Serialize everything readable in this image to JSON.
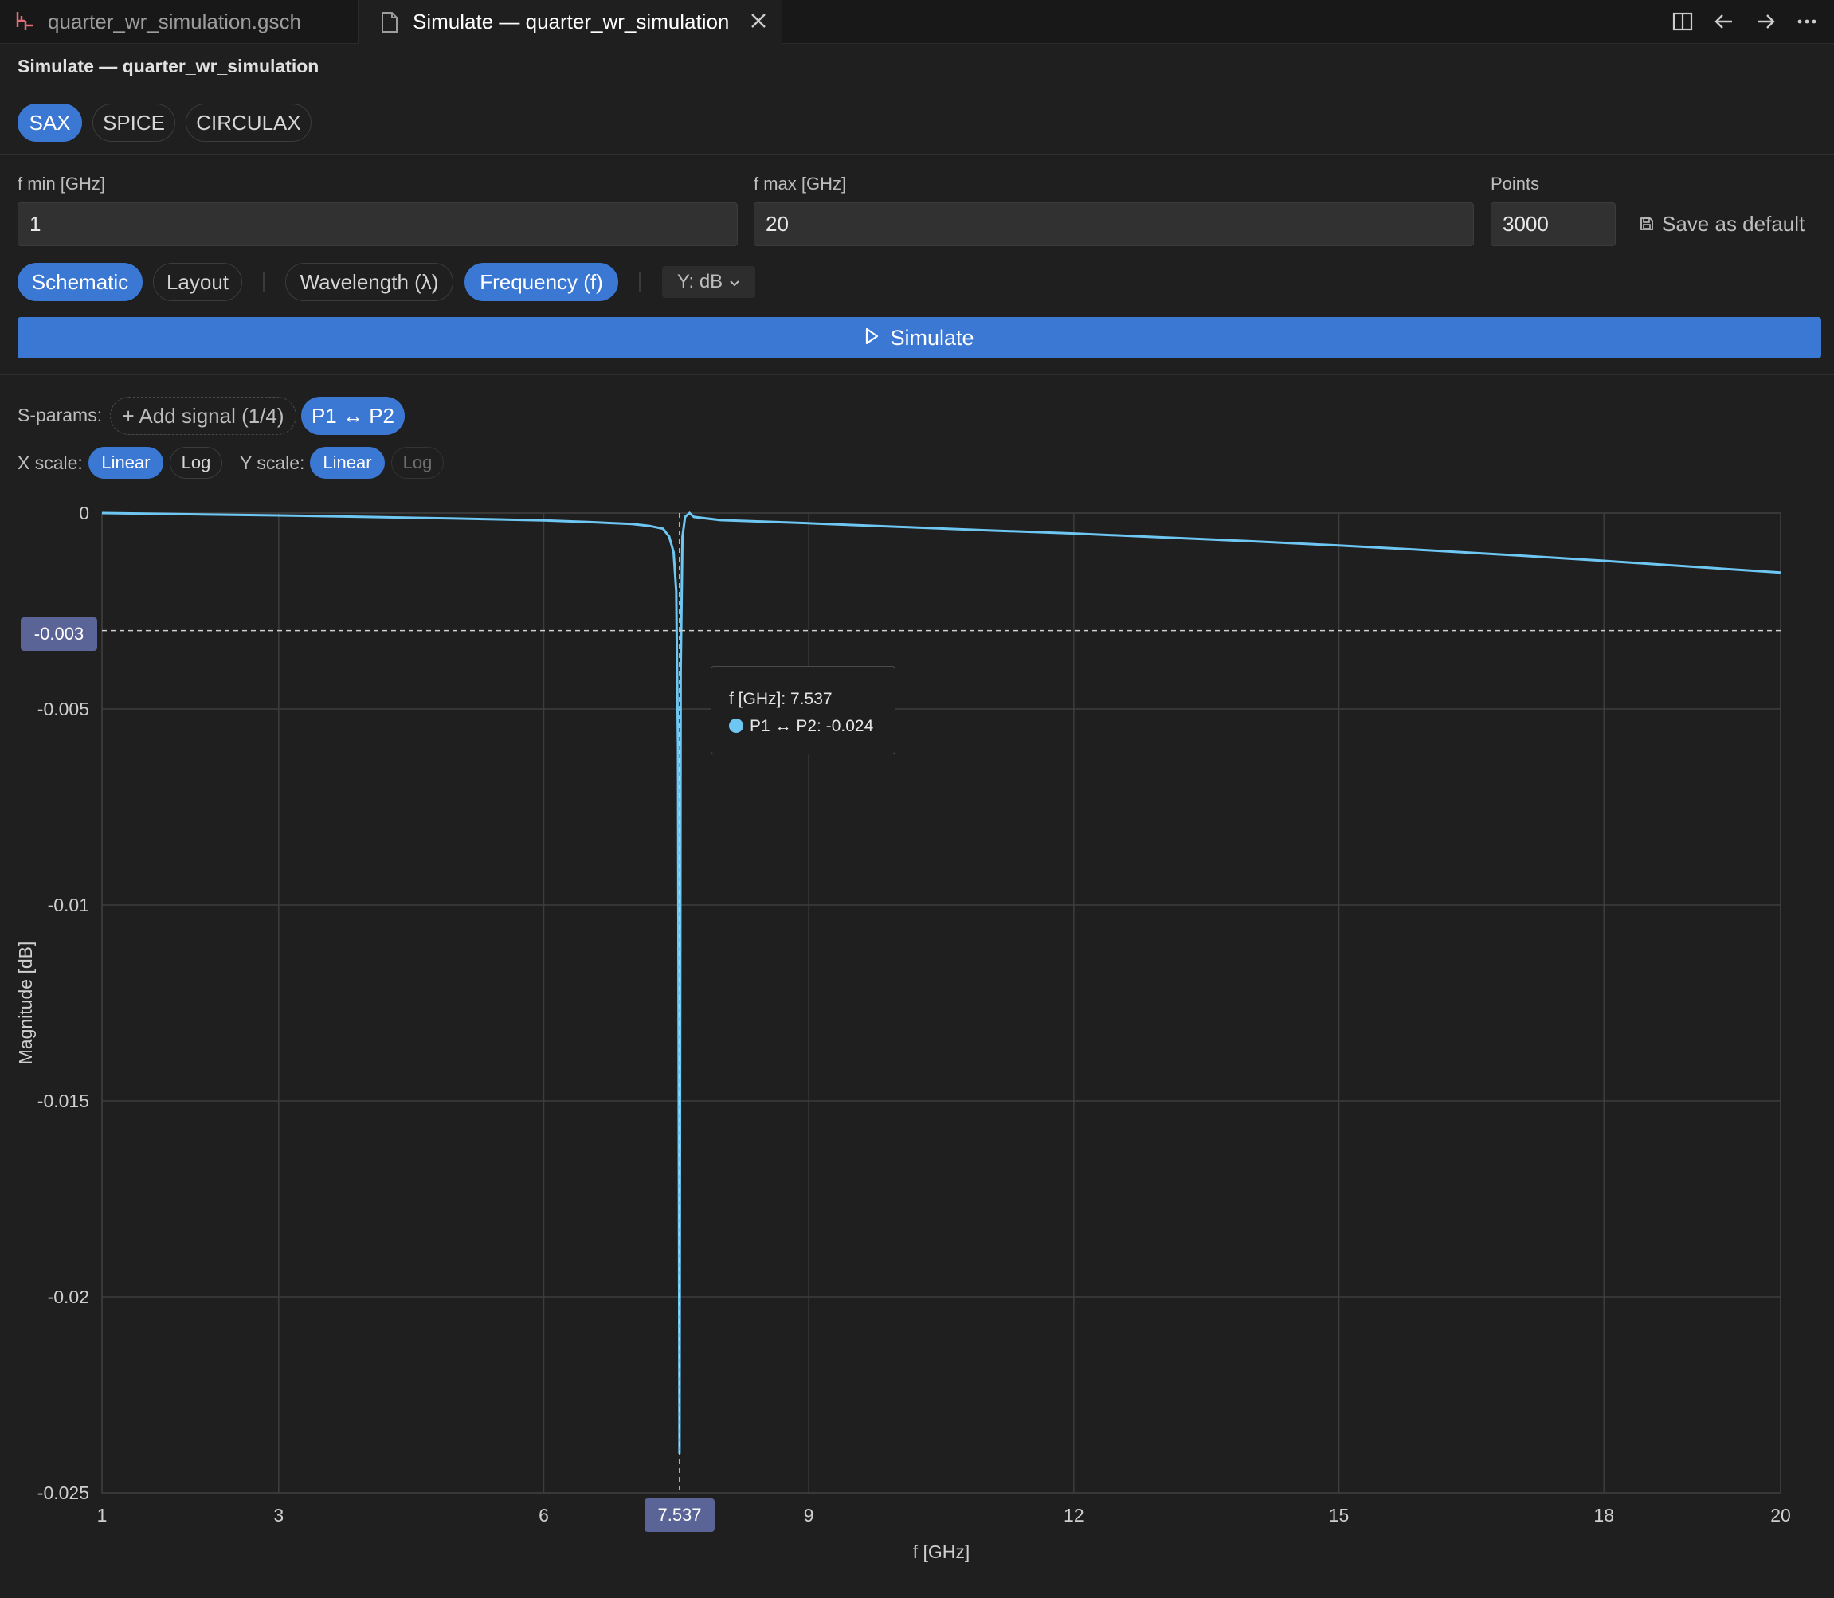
{
  "tabs": [
    {
      "label": "quarter_wr_simulation.gsch",
      "icon": "schematic-file-icon"
    },
    {
      "label": "Simulate — quarter_wr_simulation",
      "icon": "file-icon",
      "close_icon": "close-icon"
    }
  ],
  "toolbar_icons": [
    "split-editor-icon",
    "arrow-left-icon",
    "arrow-right-icon",
    "more-icon"
  ],
  "panel_title": "Simulate — quarter_wr_simulation",
  "engines": [
    "SAX",
    "SPICE",
    "CIRCULAX"
  ],
  "active_engine": "SAX",
  "fields": {
    "fmin": {
      "label": "f min [GHz]",
      "value": "1"
    },
    "fmax": {
      "label": "f max [GHz]",
      "value": "20"
    },
    "points": {
      "label": "Points",
      "value": "3000"
    }
  },
  "save_default": "Save as default",
  "views": {
    "schematic": "Schematic",
    "layout": "Layout"
  },
  "domains": {
    "wavelength": "Wavelength (λ)",
    "frequency": "Frequency (f)"
  },
  "y_unit": "Y: dB",
  "simulate_label": "Simulate",
  "sparams": {
    "label": "S-params:",
    "add": "+ Add signal (1/4)",
    "signal": "P1 ↔ P2"
  },
  "scales": {
    "x_label": "X scale:",
    "y_label": "Y scale:",
    "linear": "Linear",
    "log": "Log"
  },
  "tooltip": {
    "x_text": "f [GHz]: 7.537",
    "series_text": "P1 ↔ P2: -0.024"
  },
  "cursor_labels": {
    "x": "7.537",
    "y": "-0.003"
  },
  "colors": {
    "accent": "#3b78d4",
    "series": "#6ec6f2",
    "badge": "#5b6496"
  },
  "chart_data": {
    "type": "line",
    "xlabel": "f [GHz]",
    "ylabel": "Magnitude [dB]",
    "xlim": [
      1,
      20
    ],
    "ylim": [
      -0.025,
      0
    ],
    "x_ticks": [
      1,
      3,
      6,
      9,
      12,
      15,
      18,
      20
    ],
    "y_ticks": [
      0,
      -0.005,
      -0.01,
      -0.015,
      -0.02,
      -0.025
    ],
    "x_tick_labels": [
      "1",
      "3",
      "6",
      "9",
      "12",
      "15",
      "18",
      "20"
    ],
    "y_tick_labels": [
      "0",
      "-0.005",
      "-0.01",
      "-0.015",
      "-0.02",
      "-0.025"
    ],
    "grid": true,
    "cursor": {
      "x": 7.537,
      "y": -0.003
    },
    "series": [
      {
        "name": "P1 ↔ P2",
        "x": [
          1,
          2,
          3,
          4,
          5,
          6,
          6.5,
          7,
          7.2,
          7.35,
          7.42,
          7.47,
          7.5,
          7.52,
          7.537,
          7.55,
          7.57,
          7.6,
          7.65,
          7.7,
          8,
          9,
          10,
          11,
          12,
          13,
          14,
          15,
          16,
          17,
          18,
          19,
          20
        ],
        "y": [
          0,
          -3e-05,
          -6e-05,
          -0.0001,
          -0.00014,
          -0.00019,
          -0.00023,
          -0.00028,
          -0.00033,
          -0.0004,
          -0.0006,
          -0.001,
          -0.002,
          -0.006,
          -0.024,
          -0.004,
          -0.0006,
          -0.0001,
          0,
          -0.0001,
          -0.00018,
          -0.00026,
          -0.00035,
          -0.00044,
          -0.00052,
          -0.00062,
          -0.00072,
          -0.00083,
          -0.00095,
          -0.00108,
          -0.00122,
          -0.00137,
          -0.00152
        ]
      }
    ]
  }
}
